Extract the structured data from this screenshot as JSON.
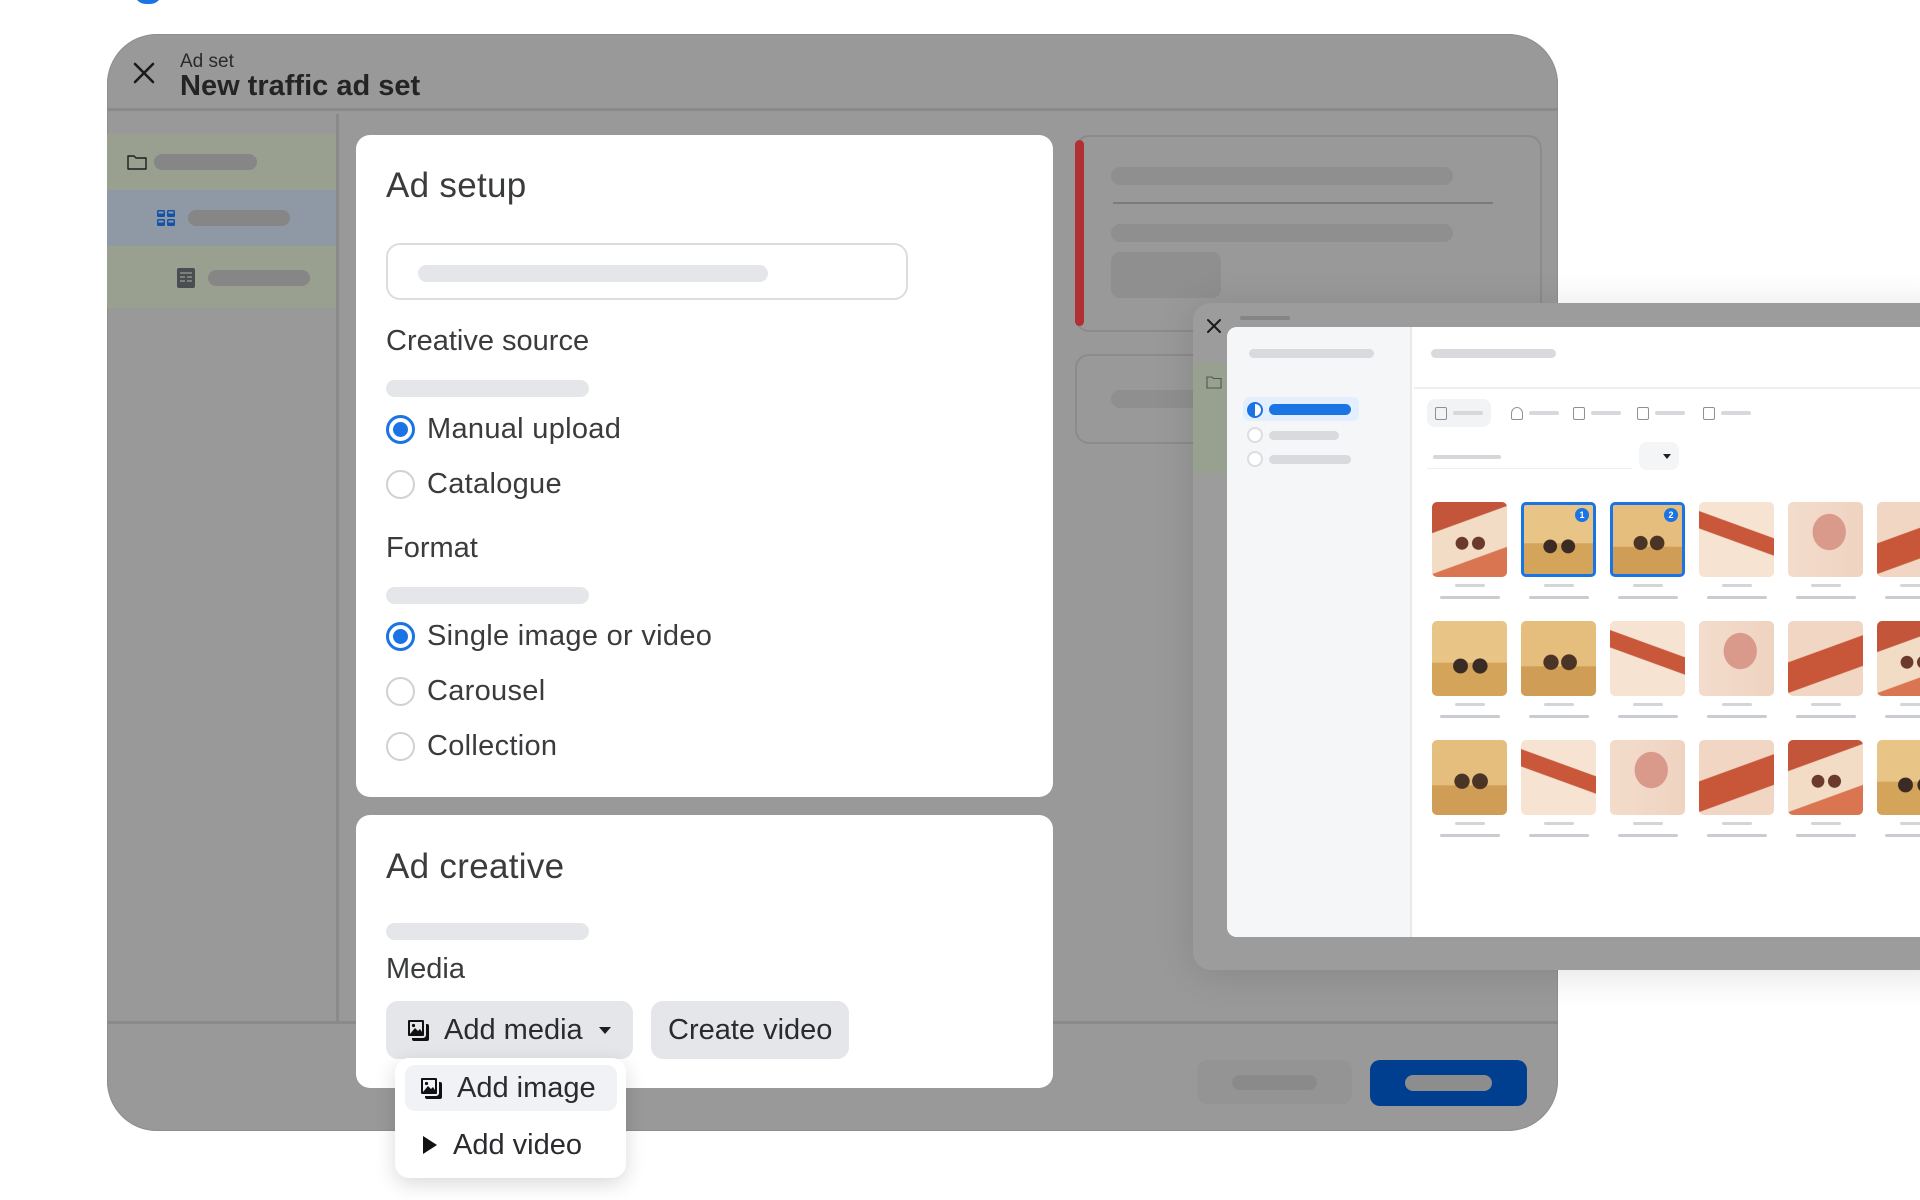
{
  "header": {
    "eyebrow": "Ad set",
    "title": "New traffic ad set",
    "close_icon": "close-icon"
  },
  "sidebar": {
    "items": [
      {
        "icon": "folder-icon",
        "state": "campaign"
      },
      {
        "icon": "grid-icon",
        "state": "ad-set-selected"
      },
      {
        "icon": "ad-icon",
        "state": "ad"
      }
    ]
  },
  "ad_setup": {
    "title": "Ad setup",
    "name_input_placeholder": "",
    "creative_source": {
      "label": "Creative source",
      "options": [
        {
          "label": "Manual upload",
          "selected": true
        },
        {
          "label": "Catalogue",
          "selected": false
        }
      ]
    },
    "format": {
      "label": "Format",
      "options": [
        {
          "label": "Single image or video",
          "selected": true
        },
        {
          "label": "Carousel",
          "selected": false
        },
        {
          "label": "Collection",
          "selected": false
        }
      ]
    }
  },
  "ad_creative": {
    "title": "Ad creative",
    "media_label": "Media",
    "add_media_label": "Add media",
    "create_video_label": "Create video",
    "menu": {
      "items": [
        {
          "label": "Add image",
          "icon": "image-icon",
          "highlighted": true
        },
        {
          "label": "Add video",
          "icon": "play-icon",
          "highlighted": false
        }
      ]
    }
  },
  "media_library": {
    "close_icon": "close-icon",
    "tabs": [
      "image-tab-icon",
      "person-icon",
      "device-icon",
      "document-icon",
      "storage-icon"
    ],
    "sort_icon": "caret-down-icon",
    "grid": {
      "columns": 6,
      "rows": 3,
      "selected": [
        {
          "index": 1,
          "badge": "1"
        },
        {
          "index": 2,
          "badge": "2"
        }
      ]
    }
  },
  "colors": {
    "accent": "#1b74e4",
    "primary_button": "#003e8f",
    "error_bar": "#b03034",
    "overlay_dim": "#999999"
  }
}
